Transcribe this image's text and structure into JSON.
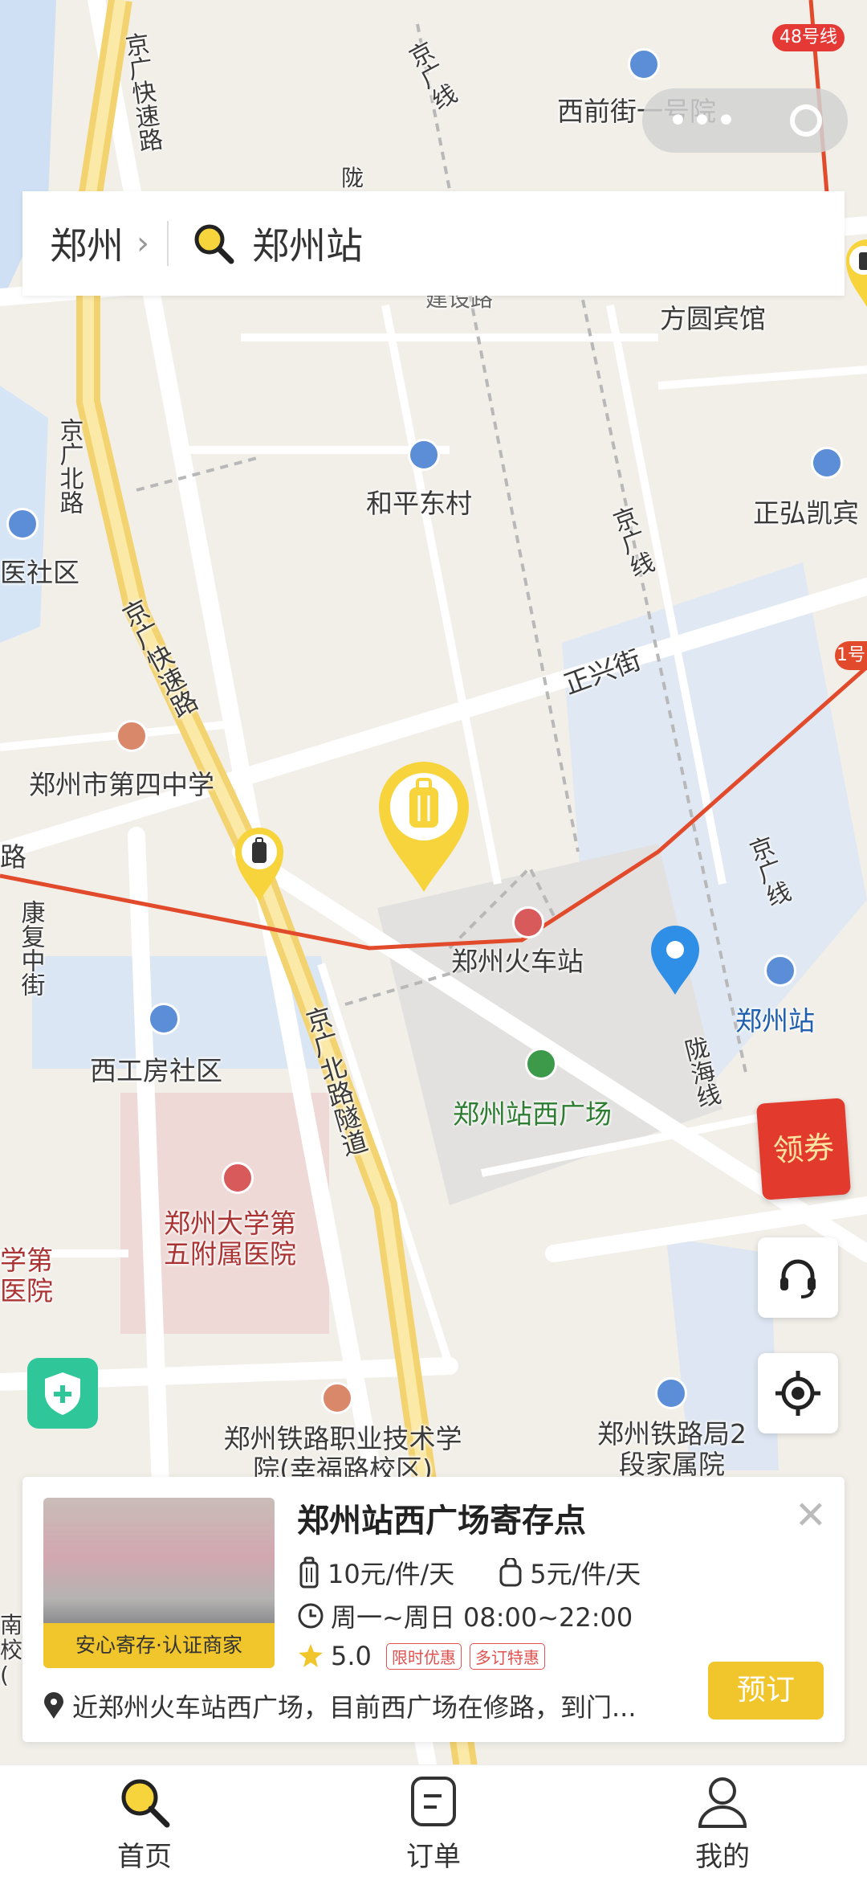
{
  "status_bar": {
    "line_badge": "48号线"
  },
  "map": {
    "road_labels": {
      "jg_expressway_top": "京广快速路",
      "jg_line_top": "京广线",
      "jg_north_road": "京广北路",
      "jg_expressway_mid": "京广快速路",
      "jg_line_mid": "京广线",
      "zhengxing_street": "正兴街",
      "jg_line_right": "京广线",
      "longhai_line": "陇海线",
      "jg_north_tunnel": "京广北路隧道",
      "kangfu_street": "康复中街",
      "road_left": "路",
      "road_top_partial": "建设路",
      "road_top_small": "陇",
      "line1_badge": "1号"
    },
    "poi_labels": {
      "xiqianjie": "西前街一号院",
      "fangyuan": "方圆宾馆",
      "hepingdongcun": "和平东村",
      "zhenghongkai": "正弘凯宾",
      "yi_community": "医社区",
      "no4_middle_school": "郑州市第四中学",
      "zhengzhou_train_station": "郑州火车站",
      "zhengzhou_station": "郑州站",
      "xigongfang": "西工房社区",
      "west_square": "郑州站西广场",
      "hospital": "郑州大学第五附属医院",
      "hospital_left": "学第医院",
      "railway_college": "郑州铁路职业技术学院(幸福路校区)",
      "railway_bureau": "郑州铁路局2段家属院",
      "left_edge_partial": "南校("
    }
  },
  "search": {
    "city": "郑州",
    "query": "郑州站"
  },
  "coupon": {
    "label": "领券"
  },
  "store": {
    "name": "郑州站西广场寄存点",
    "price_large": "10元/件/天",
    "price_small": "5元/件/天",
    "hours": "周一~周日 08:00~22:00",
    "rating": "5.0",
    "tags": [
      "限时优惠",
      "多订特惠"
    ],
    "thumb_caption": "安心寄存·认证商家",
    "address": "近郑州火车站西广场，目前西广场在修路，到门...",
    "book_label": "预订"
  },
  "tabs": [
    {
      "label": "首页",
      "icon": "search-icon"
    },
    {
      "label": "订单",
      "icon": "order-icon"
    },
    {
      "label": "我的",
      "icon": "user-icon"
    }
  ],
  "colors": {
    "accent": "#f1c62c",
    "route": "#e24a2c",
    "tag_red": "#e0514f",
    "shield": "#2fc69a"
  }
}
